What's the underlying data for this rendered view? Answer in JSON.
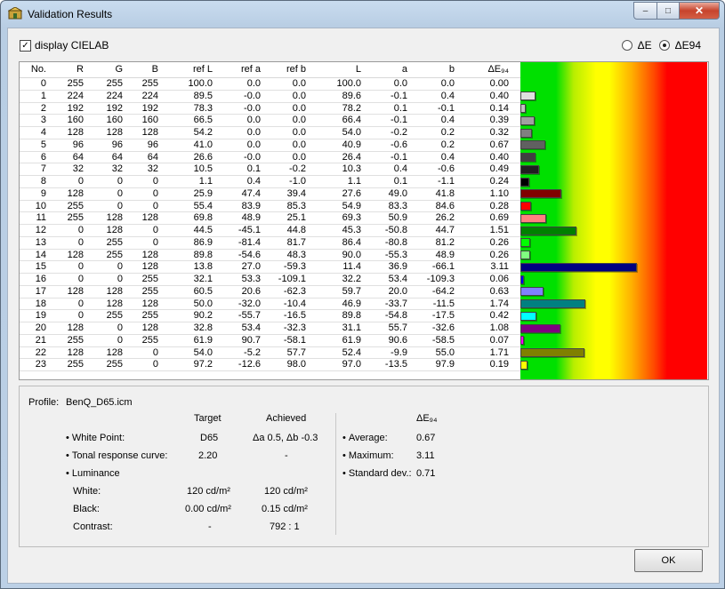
{
  "window": {
    "title": "Validation Results",
    "min_glyph": "–",
    "max_glyph": "□",
    "close_glyph": "✕"
  },
  "options": {
    "display_cielab_label": "display CIELAB",
    "display_cielab_checked": true,
    "check_glyph": "✓",
    "radio_de_label": "ΔE",
    "radio_de94_label": "ΔE94",
    "selected": "ΔE94"
  },
  "table": {
    "columns": [
      "No.",
      "R",
      "G",
      "B",
      "ref L",
      "ref a",
      "ref b",
      "L",
      "a",
      "b",
      "ΔE₉₄"
    ],
    "rows": [
      [
        "0",
        "255",
        "255",
        "255",
        "100.0",
        "0.0",
        "0.0",
        "100.0",
        "0.0",
        "0.0",
        "0.00"
      ],
      [
        "1",
        "224",
        "224",
        "224",
        "89.5",
        "-0.0",
        "0.0",
        "89.6",
        "-0.1",
        "0.4",
        "0.40"
      ],
      [
        "2",
        "192",
        "192",
        "192",
        "78.3",
        "-0.0",
        "0.0",
        "78.2",
        "0.1",
        "-0.1",
        "0.14"
      ],
      [
        "3",
        "160",
        "160",
        "160",
        "66.5",
        "0.0",
        "0.0",
        "66.4",
        "-0.1",
        "0.4",
        "0.39"
      ],
      [
        "4",
        "128",
        "128",
        "128",
        "54.2",
        "0.0",
        "0.0",
        "54.0",
        "-0.2",
        "0.2",
        "0.32"
      ],
      [
        "5",
        "96",
        "96",
        "96",
        "41.0",
        "0.0",
        "0.0",
        "40.9",
        "-0.6",
        "0.2",
        "0.67"
      ],
      [
        "6",
        "64",
        "64",
        "64",
        "26.6",
        "-0.0",
        "0.0",
        "26.4",
        "-0.1",
        "0.4",
        "0.40"
      ],
      [
        "7",
        "32",
        "32",
        "32",
        "10.5",
        "0.1",
        "-0.2",
        "10.3",
        "0.4",
        "-0.6",
        "0.49"
      ],
      [
        "8",
        "0",
        "0",
        "0",
        "1.1",
        "0.4",
        "-1.0",
        "1.1",
        "0.1",
        "-1.1",
        "0.24"
      ],
      [
        "9",
        "128",
        "0",
        "0",
        "25.9",
        "47.4",
        "39.4",
        "27.6",
        "49.0",
        "41.8",
        "1.10"
      ],
      [
        "10",
        "255",
        "0",
        "0",
        "55.4",
        "83.9",
        "85.3",
        "54.9",
        "83.3",
        "84.6",
        "0.28"
      ],
      [
        "11",
        "255",
        "128",
        "128",
        "69.8",
        "48.9",
        "25.1",
        "69.3",
        "50.9",
        "26.2",
        "0.69"
      ],
      [
        "12",
        "0",
        "128",
        "0",
        "44.5",
        "-45.1",
        "44.8",
        "45.3",
        "-50.8",
        "44.7",
        "1.51"
      ],
      [
        "13",
        "0",
        "255",
        "0",
        "86.9",
        "-81.4",
        "81.7",
        "86.4",
        "-80.8",
        "81.2",
        "0.26"
      ],
      [
        "14",
        "128",
        "255",
        "128",
        "89.8",
        "-54.6",
        "48.3",
        "90.0",
        "-55.3",
        "48.9",
        "0.26"
      ],
      [
        "15",
        "0",
        "0",
        "128",
        "13.8",
        "27.0",
        "-59.3",
        "11.4",
        "36.9",
        "-66.1",
        "3.11"
      ],
      [
        "16",
        "0",
        "0",
        "255",
        "32.1",
        "53.3",
        "-109.1",
        "32.2",
        "53.4",
        "-109.3",
        "0.06"
      ],
      [
        "17",
        "128",
        "128",
        "255",
        "60.5",
        "20.6",
        "-62.3",
        "59.7",
        "20.0",
        "-64.2",
        "0.63"
      ],
      [
        "18",
        "0",
        "128",
        "128",
        "50.0",
        "-32.0",
        "-10.4",
        "46.9",
        "-33.7",
        "-11.5",
        "1.74"
      ],
      [
        "19",
        "0",
        "255",
        "255",
        "90.2",
        "-55.7",
        "-16.5",
        "89.8",
        "-54.8",
        "-17.5",
        "0.42"
      ],
      [
        "20",
        "128",
        "0",
        "128",
        "32.8",
        "53.4",
        "-32.3",
        "31.1",
        "55.7",
        "-32.6",
        "1.08"
      ],
      [
        "21",
        "255",
        "0",
        "255",
        "61.9",
        "90.7",
        "-58.1",
        "61.9",
        "90.6",
        "-58.5",
        "0.07"
      ],
      [
        "22",
        "128",
        "128",
        "0",
        "54.0",
        "-5.2",
        "57.7",
        "52.4",
        "-9.9",
        "55.0",
        "1.71"
      ],
      [
        "23",
        "255",
        "255",
        "0",
        "97.2",
        "-12.6",
        "98.0",
        "97.0",
        "-13.5",
        "97.9",
        "0.19"
      ]
    ]
  },
  "summary": {
    "profile_label": "Profile:",
    "profile_value": "BenQ_D65.icm",
    "target_header": "Target",
    "achieved_header": "Achieved",
    "de94_header": "ΔE₉₄",
    "white_point_label": "White Point:",
    "white_point_target": "D65",
    "white_point_achieved": "Δa 0.5, Δb -0.3",
    "trc_label": "Tonal response curve:",
    "trc_target": "2.20",
    "trc_achieved": "-",
    "luminance_label": "Luminance",
    "white_label": "White:",
    "white_target": "120 cd/m²",
    "white_achieved": "120 cd/m²",
    "black_label": "Black:",
    "black_target": "0.00 cd/m²",
    "black_achieved": "0.15 cd/m²",
    "contrast_label": "Contrast:",
    "contrast_target": "-",
    "contrast_achieved": "792 : 1",
    "average_label": "Average:",
    "average_value": "0.67",
    "maximum_label": "Maximum:",
    "maximum_value": "3.11",
    "stddev_label": "Standard dev.:",
    "stddev_value": "0.71"
  },
  "ok_label": "OK"
}
